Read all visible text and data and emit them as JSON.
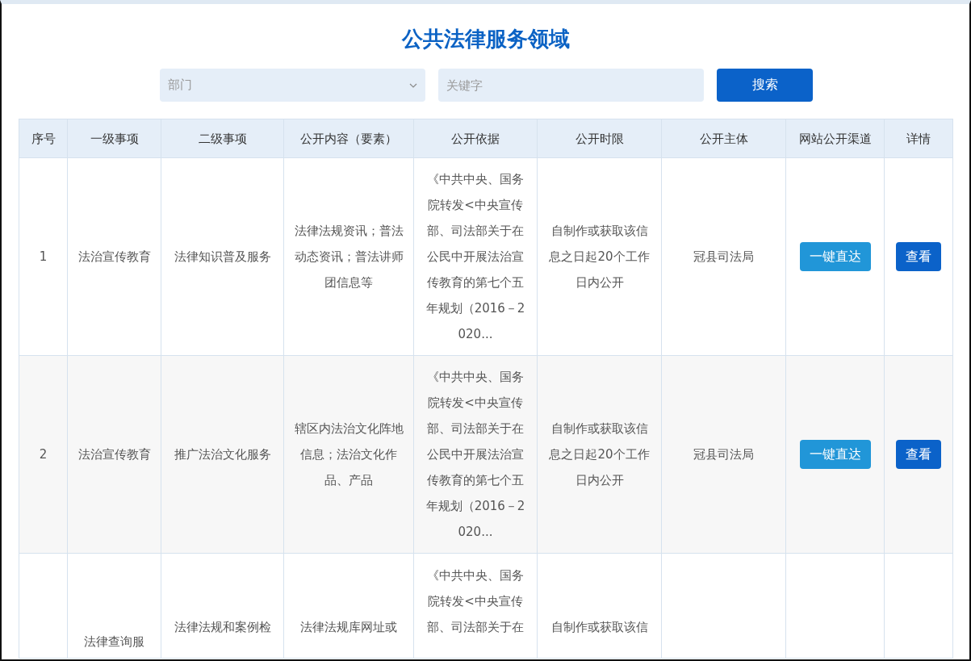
{
  "title": "公共法律服务领域",
  "filters": {
    "department": {
      "placeholder": "部门"
    },
    "keyword": {
      "placeholder": "关键字"
    },
    "search_button": "搜索"
  },
  "table": {
    "columns": [
      "序号",
      "一级事项",
      "二级事项",
      "公开内容（要素）",
      "公开依据",
      "公开时限",
      "公开主体",
      "网站公开渠道",
      "详情"
    ],
    "rows": [
      {
        "index": "1",
        "level1": "法治宣传教育",
        "level2": "法律知识普及服务",
        "content": "法律法规资讯；普法动态资讯；普法讲师团信息等",
        "basis": "《中共中央、国务院转发<中央宣传部、司法部关于在公民中开展法治宣传教育的第七个五年规划（2016－2020...",
        "deadline": "自制作或获取该信息之日起20个工作日内公开",
        "subject": "冠县司法局",
        "channel_button": "一键直达",
        "detail_button": "查看"
      },
      {
        "index": "2",
        "level1": "法治宣传教育",
        "level2": "推广法治文化服务",
        "content": "辖区内法治文化阵地信息；法治文化作品、产品",
        "basis": "《中共中央、国务院转发<中央宣传部、司法部关于在公民中开展法治宣传教育的第七个五年规划（2016－2020...",
        "deadline": "自制作或获取该信息之日起20个工作日内公开",
        "subject": "冠县司法局",
        "channel_button": "一键直达",
        "detail_button": "查看"
      },
      {
        "level1": "法律查询服",
        "level2": "法律法规和案例检",
        "content": "法律法规库网址或",
        "basis": "《中共中央、国务院转发<中央宣传部、司法部关于在",
        "deadline": "自制作或获取该信"
      }
    ]
  }
}
